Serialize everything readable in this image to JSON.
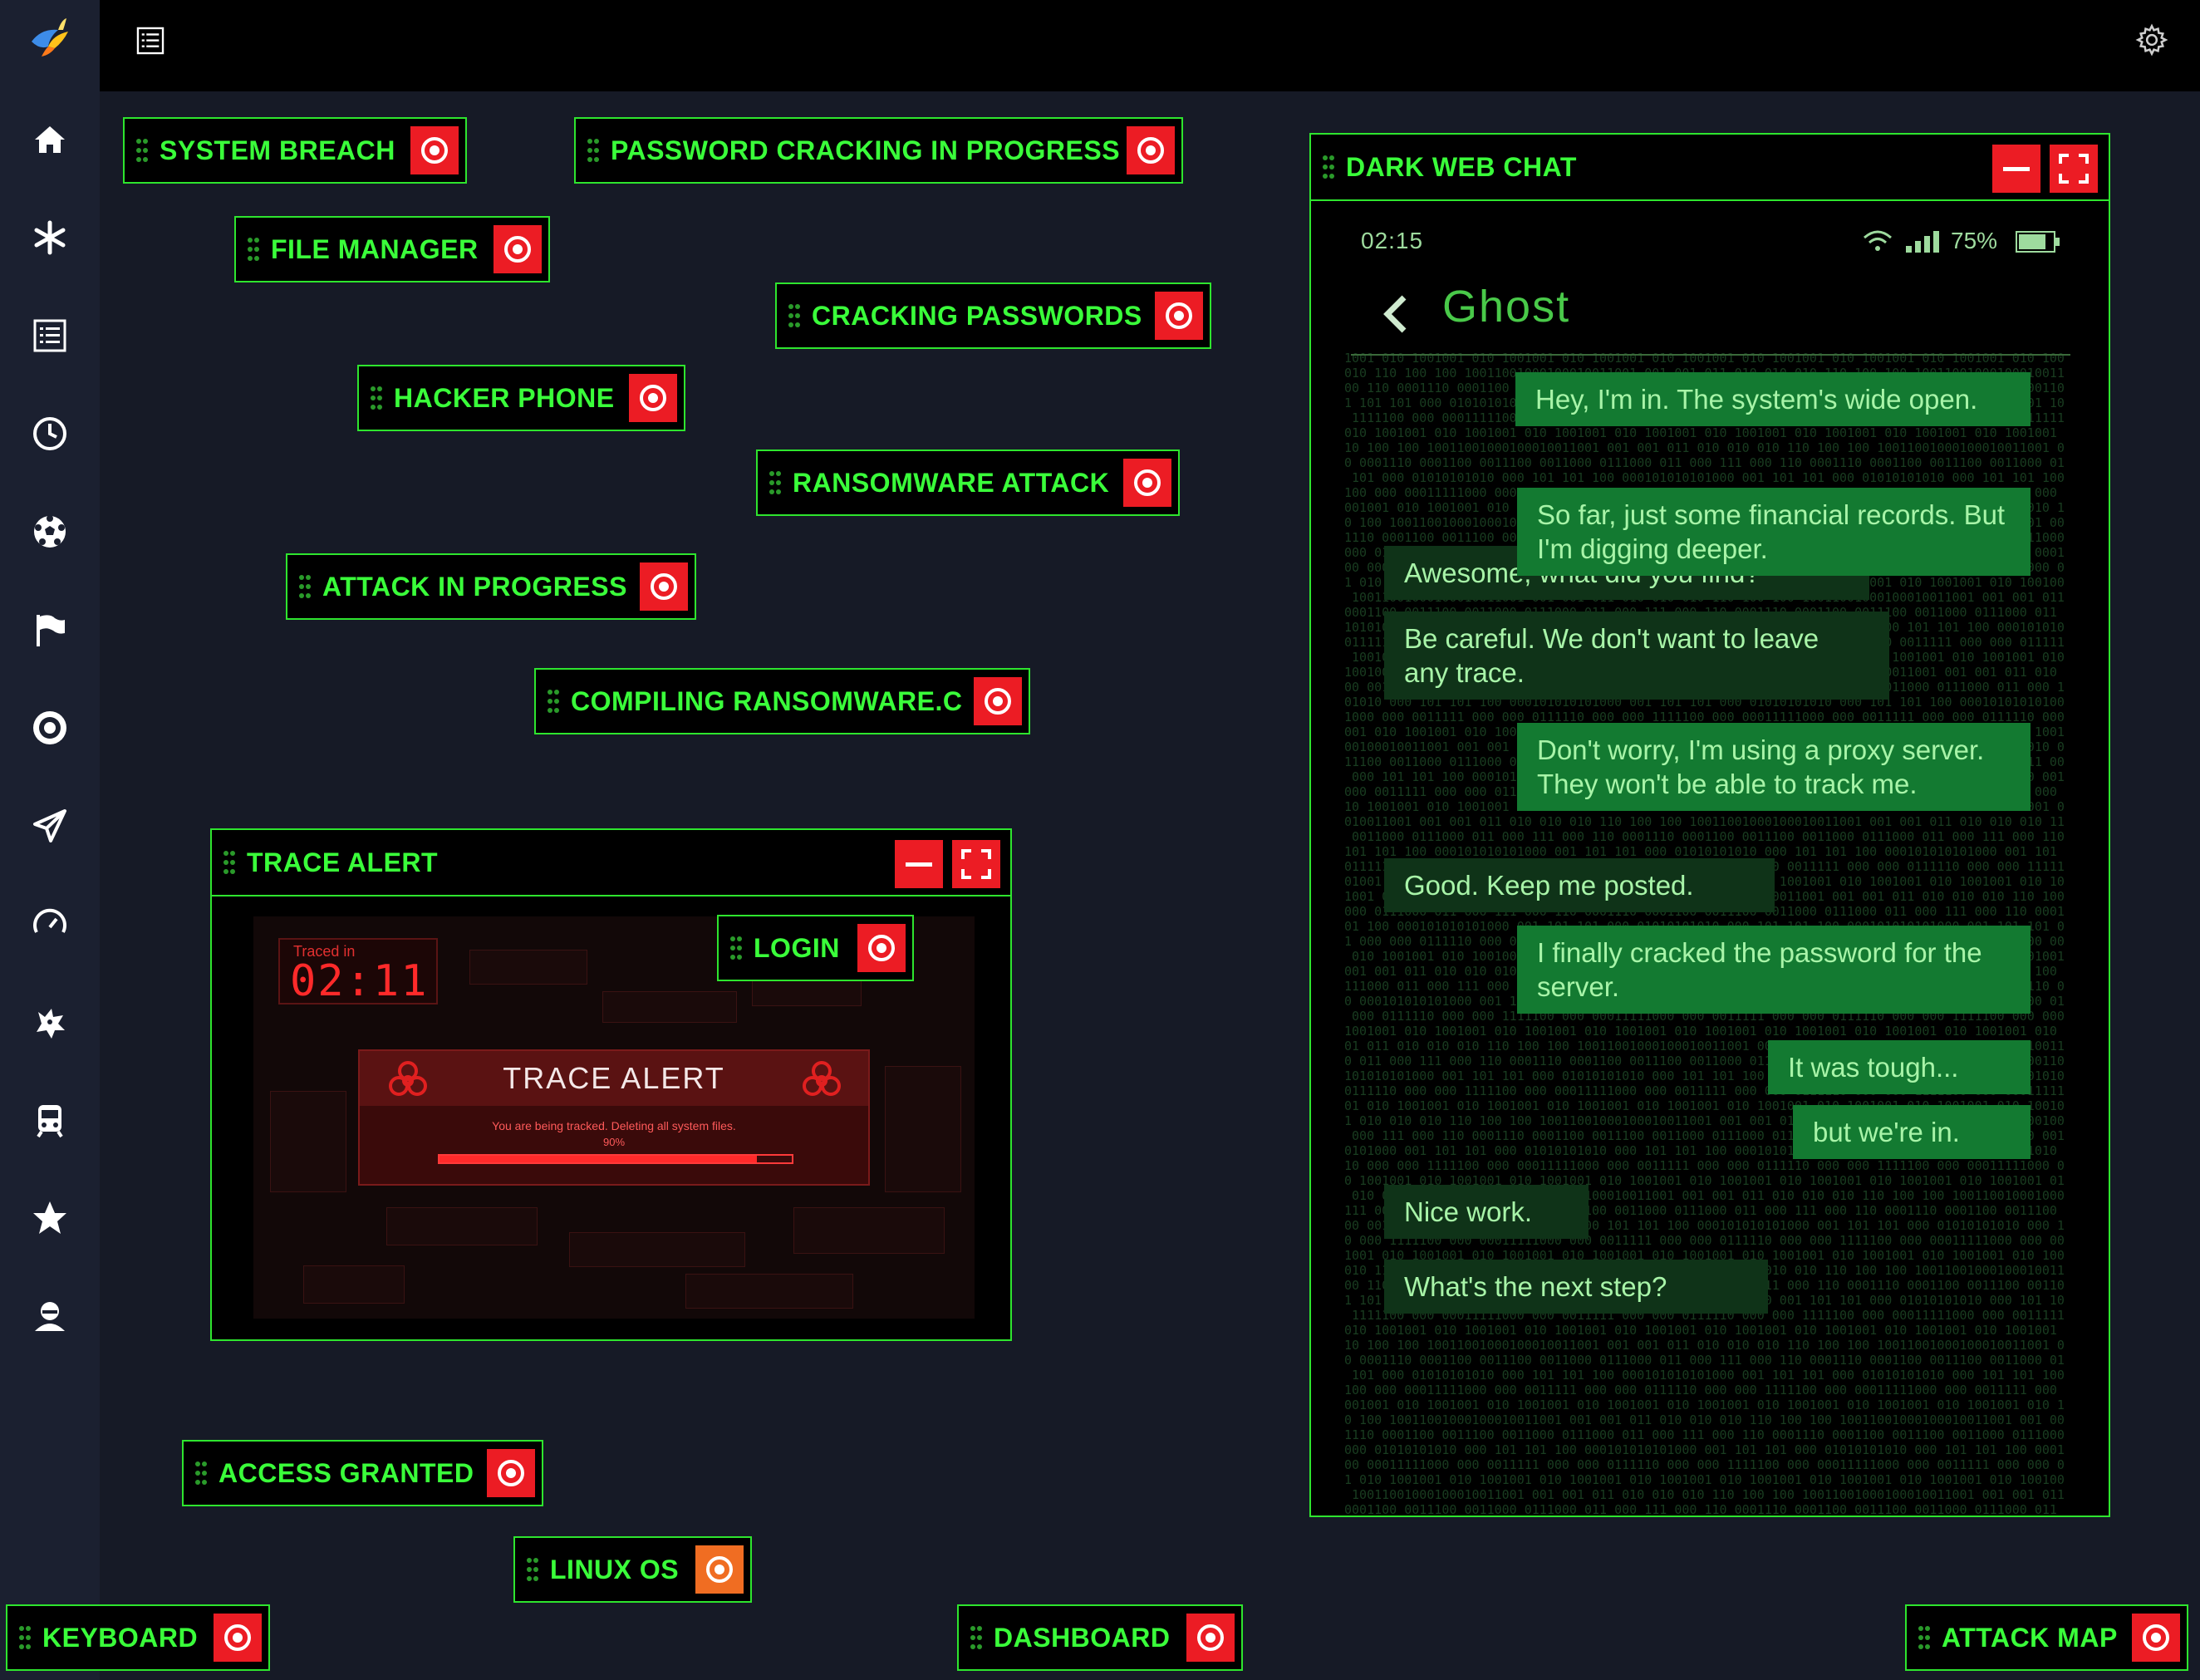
{
  "colors": {
    "accent_green": "#3aff3a",
    "alert_red": "#ec1c24",
    "orange": "#f06d22",
    "background": "#161a26"
  },
  "sidebar": {
    "icons": [
      "home-icon",
      "asterisk-icon",
      "list-icon",
      "clock-icon",
      "soccer-ball-icon",
      "flag-icon",
      "target-icon",
      "paper-plane-icon",
      "speedometer-icon",
      "dragon-icon",
      "train-icon",
      "star-icon",
      "user-icon"
    ]
  },
  "topbar": {
    "menu_icon": "list-icon",
    "settings_icon": "gear-icon"
  },
  "widgets": {
    "system_breach": "SYSTEM BREACH",
    "password_cracking": "PASSWORD CRACKING IN PROGRESS",
    "file_manager": "FILE MANAGER",
    "cracking_passwords": "CRACKING PASSWORDS",
    "hacker_phone": "HACKER PHONE",
    "ransomware_attack": "RANSOMWARE ATTACK",
    "attack_in_progress": "ATTACK IN PROGRESS",
    "compiling_ransomware": "COMPILING RANSOMWARE.C",
    "login": "LOGIN",
    "access_granted": "ACCESS GRANTED",
    "linux_os": "LINUX OS",
    "keyboard": "KEYBOARD",
    "dashboard": "DASHBOARD",
    "attack_map": "ATTACK MAP"
  },
  "trace_window": {
    "title": "TRACE ALERT",
    "traced_label": "Traced in",
    "traced_time": "02:11",
    "alert_title": "TRACE ALERT",
    "alert_message": "You are being tracked. Deleting all system files.",
    "progress_label": "90%",
    "progress": 0.9
  },
  "chat_window": {
    "title": "DARK WEB CHAT",
    "status_time": "02:15",
    "battery": "75%",
    "contact": "Ghost",
    "messages": [
      {
        "from": "me",
        "text": "Hey, I'm in. The system's wide open."
      },
      {
        "from": "them",
        "text": "Awesome, what did you find?"
      },
      {
        "from": "me",
        "text": "So far, just some financial records. But I'm digging deeper."
      },
      {
        "from": "them",
        "text": "Be careful. We don't want to leave any trace."
      },
      {
        "from": "me",
        "text": "Don't worry, I'm using a proxy server. They won't be able to track me."
      },
      {
        "from": "them",
        "text": "Good. Keep me posted."
      },
      {
        "from": "me",
        "text": "I finally cracked the password for the server."
      },
      {
        "from": "me",
        "text": "It was tough..."
      },
      {
        "from": "me",
        "text": "but we're in."
      },
      {
        "from": "them",
        "text": "Nice work."
      },
      {
        "from": "them",
        "text": "What's the next step?"
      }
    ]
  }
}
